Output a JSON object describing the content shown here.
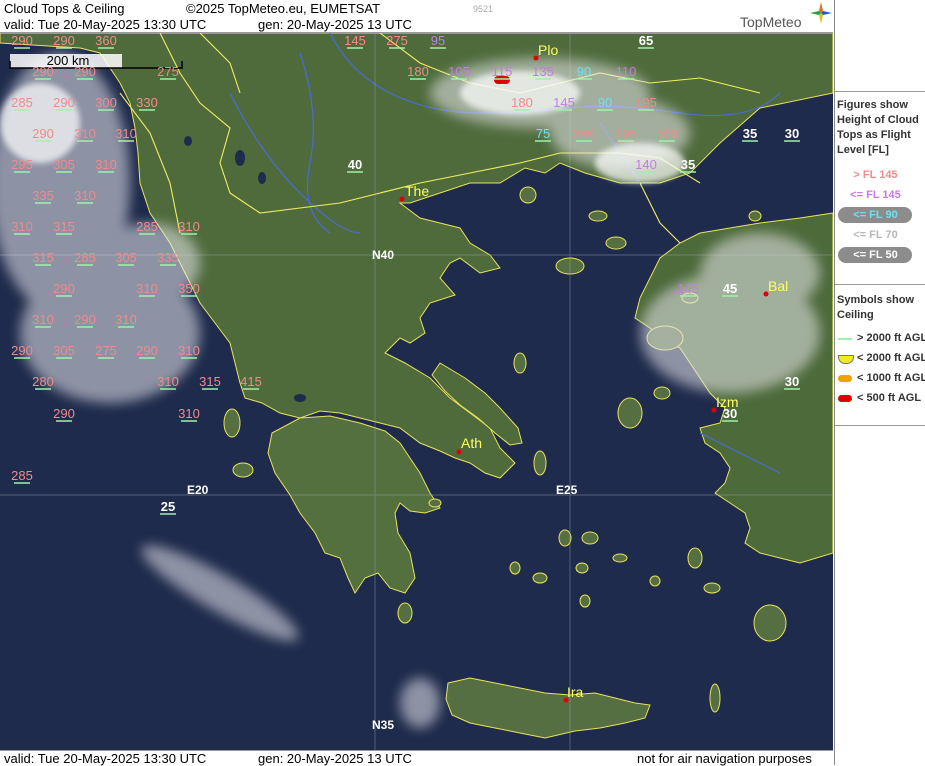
{
  "header": {
    "title": "Cloud Tops & Ceiling",
    "copyright": "©2025 TopMeteo.eu, EUMETSAT",
    "code": "9521",
    "valid": "valid:  Tue  20-May-2025  13:30 UTC",
    "gen": "gen: 20-May-2025 13 UTC",
    "brand": "TopMeteo"
  },
  "footer": {
    "valid": "valid:  Tue  20-May-2025  13:30 UTC",
    "gen": "gen: 20-May-2025 13 UTC",
    "disclaimer": "not for air navigation purposes"
  },
  "scale": {
    "label": "200 km"
  },
  "graticule": {
    "n40": "N40",
    "n35": "N35",
    "e20": "E20",
    "e25": "E25"
  },
  "cities": {
    "plo": "Plo",
    "the": "The",
    "ath": "Ath",
    "bal": "Bal",
    "izm": "Izm",
    "ira": "Ira"
  },
  "legend": {
    "figures_title": [
      "Figures show",
      "Height of Cloud",
      "Tops as Flight",
      "Level  [FL]"
    ],
    "classes": [
      {
        "label": "> FL 145",
        "color": "#f08b8b",
        "pill": false
      },
      {
        "label": "<= FL 145",
        "color": "#c87be0",
        "pill": false
      },
      {
        "label": "<= FL 90",
        "color": "#6fe0f0",
        "pill": true
      },
      {
        "label": "<= FL 70",
        "color": "#b8b8b8",
        "pill": false
      },
      {
        "label": "<= FL 50",
        "color": "#ffffff",
        "pill": true
      }
    ],
    "symbols_title": [
      "Symbols show",
      "Ceiling"
    ],
    "symbols": [
      {
        "label": "> 2000 ft AGL",
        "color": "#9ef2a8",
        "shape": "line"
      },
      {
        "label": "< 2000 ft AGL",
        "color": "#f2ea20",
        "shape": "half"
      },
      {
        "label": "< 1000 ft AGL",
        "color": "#f0a000",
        "shape": "pill"
      },
      {
        "label": "< 500 ft AGL",
        "color": "#e00000",
        "shape": "pill"
      }
    ]
  },
  "colors": {
    "high": "#f08b8b",
    "mid": "#c87be0",
    "lowmid": "#6fe0f0",
    "low": "#ffffff",
    "ceil_ok": "#9ef2a8",
    "sea": "#1e2a4a",
    "land": "#4e6a3a",
    "border": "#f2ee60",
    "river": "#4a6ad8"
  },
  "cloud_tops": [
    {
      "v": "290",
      "c": "high"
    },
    {
      "v": "290",
      "c": "high"
    },
    {
      "v": "360",
      "c": "high"
    },
    {
      "v": "145",
      "c": "high"
    },
    {
      "v": "275",
      "c": "high"
    },
    {
      "v": "95",
      "c": "mid"
    },
    {
      "v": "65",
      "c": "low"
    },
    {
      "v": "290",
      "c": "high"
    },
    {
      "v": "290",
      "c": "high"
    },
    {
      "v": "275",
      "c": "high"
    },
    {
      "v": "180",
      "c": "high"
    },
    {
      "v": "105",
      "c": "mid"
    },
    {
      "v": "115",
      "c": "mid"
    },
    {
      "v": "135",
      "c": "mid"
    },
    {
      "v": "90",
      "c": "lowmid"
    },
    {
      "v": "110",
      "c": "mid"
    },
    {
      "v": "285",
      "c": "high"
    },
    {
      "v": "290",
      "c": "high"
    },
    {
      "v": "300",
      "c": "high"
    },
    {
      "v": "330",
      "c": "high"
    },
    {
      "v": "180",
      "c": "high"
    },
    {
      "v": "145",
      "c": "mid"
    },
    {
      "v": "90",
      "c": "lowmid"
    },
    {
      "v": "195",
      "c": "high"
    },
    {
      "v": "290",
      "c": "high"
    },
    {
      "v": "310",
      "c": "high"
    },
    {
      "v": "310",
      "c": "high"
    },
    {
      "v": "75",
      "c": "lowmid"
    },
    {
      "v": "280",
      "c": "high"
    },
    {
      "v": "195",
      "c": "high"
    },
    {
      "v": "160",
      "c": "high"
    },
    {
      "v": "35",
      "c": "low"
    },
    {
      "v": "30",
      "c": "low"
    },
    {
      "v": "295",
      "c": "high"
    },
    {
      "v": "305",
      "c": "high"
    },
    {
      "v": "310",
      "c": "high"
    },
    {
      "v": "40",
      "c": "low"
    },
    {
      "v": "140",
      "c": "mid"
    },
    {
      "v": "35",
      "c": "low"
    },
    {
      "v": "335",
      "c": "high"
    },
    {
      "v": "310",
      "c": "high"
    },
    {
      "v": "310",
      "c": "high"
    },
    {
      "v": "315",
      "c": "high"
    },
    {
      "v": "285",
      "c": "high"
    },
    {
      "v": "310",
      "c": "high"
    },
    {
      "v": "315",
      "c": "high"
    },
    {
      "v": "285",
      "c": "high"
    },
    {
      "v": "305",
      "c": "high"
    },
    {
      "v": "335",
      "c": "high"
    },
    {
      "v": "290",
      "c": "high"
    },
    {
      "v": "310",
      "c": "high"
    },
    {
      "v": "350",
      "c": "high"
    },
    {
      "v": "145",
      "c": "mid"
    },
    {
      "v": "45",
      "c": "low"
    },
    {
      "v": "310",
      "c": "high"
    },
    {
      "v": "290",
      "c": "high"
    },
    {
      "v": "310",
      "c": "high"
    },
    {
      "v": "290",
      "c": "high"
    },
    {
      "v": "305",
      "c": "high"
    },
    {
      "v": "275",
      "c": "high"
    },
    {
      "v": "290",
      "c": "high"
    },
    {
      "v": "310",
      "c": "high"
    },
    {
      "v": "280",
      "c": "high"
    },
    {
      "v": "310",
      "c": "high"
    },
    {
      "v": "315",
      "c": "high"
    },
    {
      "v": "415",
      "c": "high"
    },
    {
      "v": "30",
      "c": "low"
    },
    {
      "v": "290",
      "c": "high"
    },
    {
      "v": "310",
      "c": "high"
    },
    {
      "v": "30",
      "c": "low"
    },
    {
      "v": "285",
      "c": "high"
    },
    {
      "v": "25",
      "c": "low"
    }
  ]
}
